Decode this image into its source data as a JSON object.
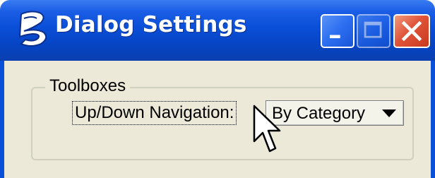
{
  "window": {
    "title": "Dialog Settings",
    "icon": "bentley-b-icon",
    "buttons": {
      "minimize": "minimize-icon",
      "maximize": "maximize-icon",
      "close": "close-icon"
    }
  },
  "group": {
    "label": "Toolboxes",
    "nav_label": "Up/Down Navigation:",
    "select_value": "By Category"
  },
  "colors": {
    "titlebar": "#0a4fd8",
    "close": "#e0543a",
    "client": "#ece9d8"
  }
}
